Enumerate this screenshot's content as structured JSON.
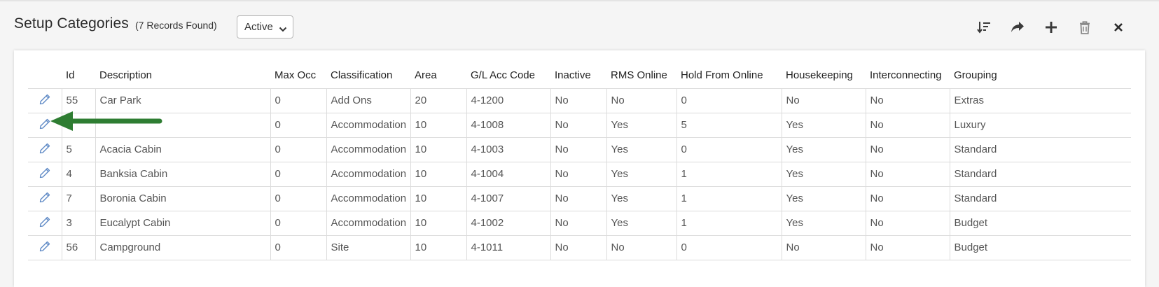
{
  "header": {
    "title": "Setup Categories",
    "record_count": "(7 Records Found)",
    "status_filter": "Active"
  },
  "toolbar": {
    "icons": [
      "sort-icon",
      "share-icon",
      "add-icon",
      "trash-icon",
      "close-icon"
    ]
  },
  "table": {
    "columns": [
      "Id",
      "Description",
      "Max Occ",
      "Classification",
      "Area",
      "G/L Acc Code",
      "Inactive",
      "RMS Online",
      "Hold From Online",
      "Housekeeping",
      "Interconnecting",
      "Grouping"
    ],
    "rows": [
      [
        "55",
        "Car Park",
        "0",
        "Add Ons",
        "20",
        "4-1200",
        "No",
        "No",
        "0",
        "No",
        "No",
        "Extras"
      ],
      [
        "",
        "",
        "0",
        "Accommodation",
        "10",
        "4-1008",
        "No",
        "Yes",
        "5",
        "Yes",
        "No",
        "Luxury"
      ],
      [
        "5",
        "Acacia Cabin",
        "0",
        "Accommodation",
        "10",
        "4-1003",
        "No",
        "Yes",
        "0",
        "Yes",
        "No",
        "Standard"
      ],
      [
        "4",
        "Banksia Cabin",
        "0",
        "Accommodation",
        "10",
        "4-1004",
        "No",
        "Yes",
        "1",
        "Yes",
        "No",
        "Standard"
      ],
      [
        "7",
        "Boronia Cabin",
        "0",
        "Accommodation",
        "10",
        "4-1007",
        "No",
        "Yes",
        "1",
        "Yes",
        "No",
        "Standard"
      ],
      [
        "3",
        "Eucalypt Cabin",
        "0",
        "Accommodation",
        "10",
        "4-1002",
        "No",
        "Yes",
        "1",
        "Yes",
        "No",
        "Budget"
      ],
      [
        "56",
        "Campground",
        "0",
        "Site",
        "10",
        "4-1011",
        "No",
        "No",
        "0",
        "No",
        "No",
        "Budget"
      ]
    ]
  },
  "colors": {
    "edit_icon": "#5b87c4",
    "arrow": "#2e7d32",
    "toolbar_icon": "#3a3a3a"
  }
}
